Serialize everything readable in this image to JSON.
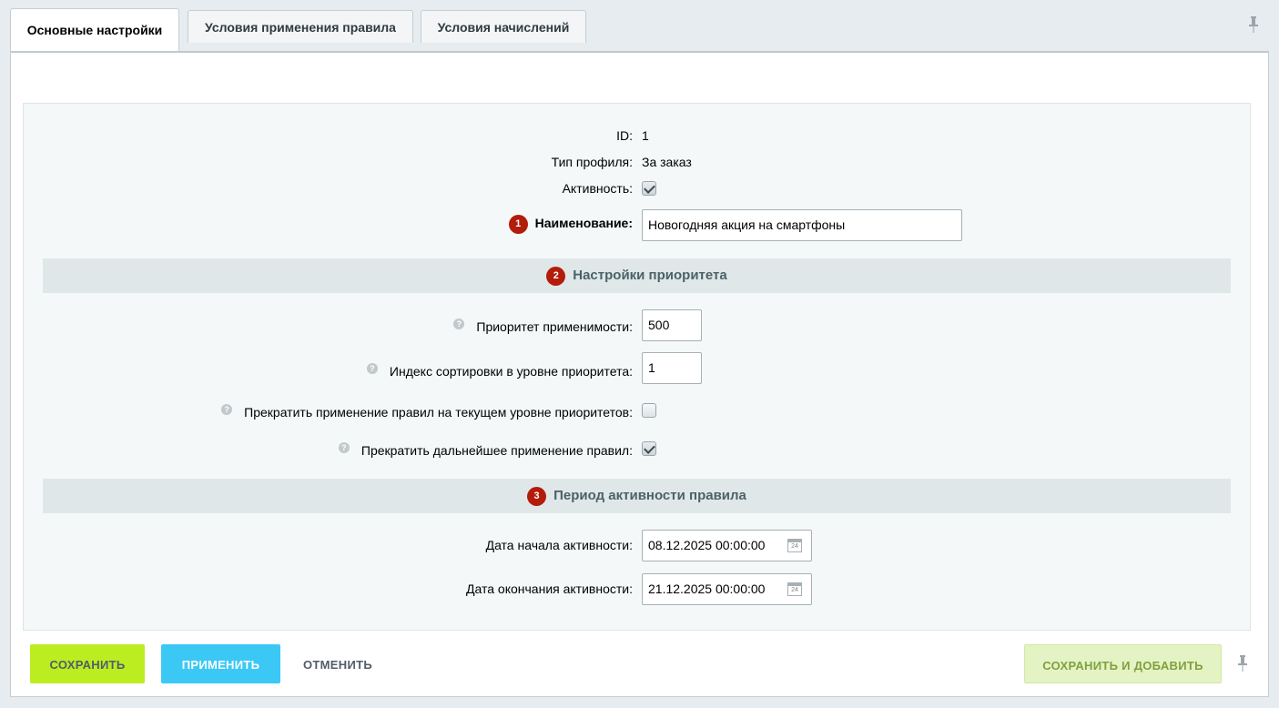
{
  "tabs": [
    {
      "label": "Основные настройки",
      "active": true
    },
    {
      "label": "Условия применения правила",
      "active": false
    },
    {
      "label": "Условия начислений",
      "active": false
    }
  ],
  "fields": {
    "id_label": "ID:",
    "id_value": "1",
    "profile_type_label": "Тип профиля:",
    "profile_type_value": "За заказ",
    "active_label": "Активность:",
    "active_checked": true,
    "name_badge": "1",
    "name_label": "Наименование:",
    "name_value": "Новогодняя акция на смартфоны"
  },
  "priority_section": {
    "badge": "2",
    "title": "Настройки приоритета",
    "priority_label": "Приоритет применимости:",
    "priority_value": "500",
    "sort_label": "Индекс сортировки в уровне приоритета:",
    "sort_value": "1",
    "stop_level_label": "Прекратить применение правил на текущем уровне приоритетов:",
    "stop_level_checked": false,
    "stop_further_label": "Прекратить дальнейшее применение правил:",
    "stop_further_checked": true,
    "help_glyph": "?"
  },
  "period_section": {
    "badge": "3",
    "title": "Период активности правила",
    "start_label": "Дата начала активности:",
    "start_value": "08.12.2025 00:00:00",
    "end_label": "Дата окончания активности:",
    "end_value": "21.12.2025 00:00:00",
    "calendar_day": "24"
  },
  "buttons": {
    "save": "СОХРАНИТЬ",
    "apply": "ПРИМЕНИТЬ",
    "cancel": "ОТМЕНИТЬ",
    "save_add": "СОХРАНИТЬ И ДОБАВИТЬ"
  },
  "icons": {
    "pin": "pin-icon",
    "calendar": "calendar-icon",
    "help": "help-icon"
  },
  "colors": {
    "badge": "#b31b0b",
    "save_button": "#bbed21",
    "apply_button": "#3bc8f5",
    "save_add_button": "#e4f3c3"
  }
}
